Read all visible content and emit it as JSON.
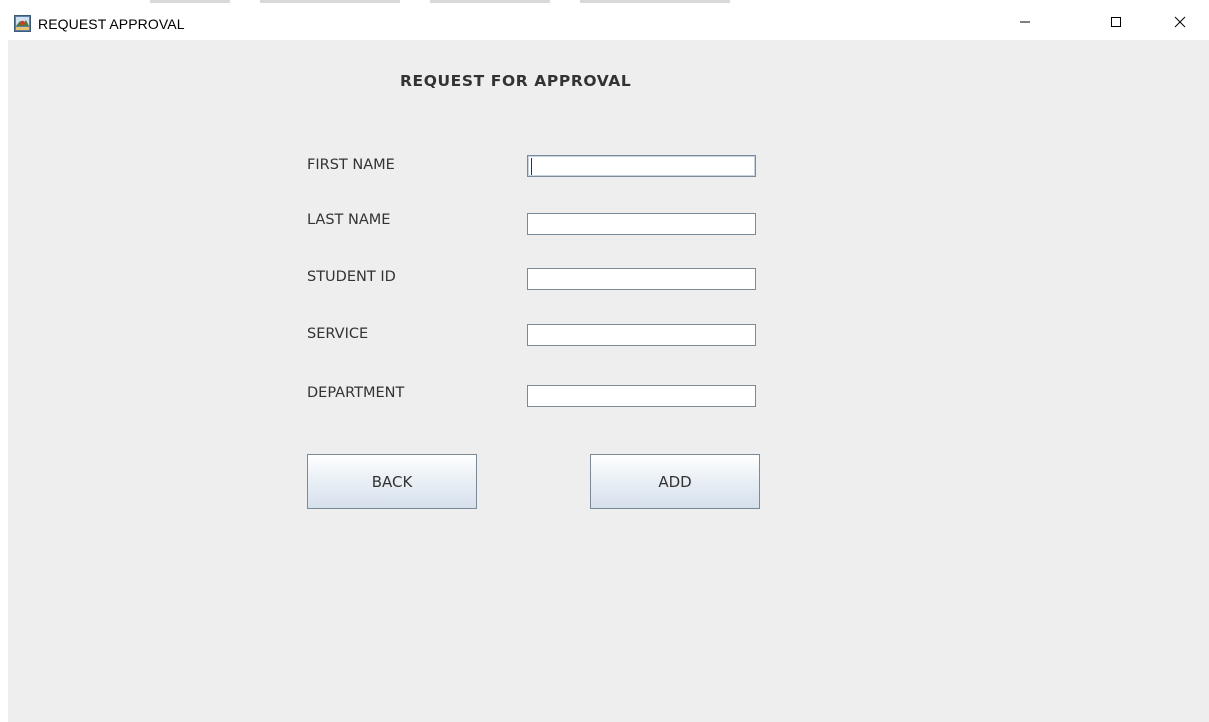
{
  "window": {
    "title": "REQUEST APPROVAL",
    "controls": {
      "minimize": "minimize-icon",
      "maximize": "maximize-icon",
      "close": "close-icon"
    }
  },
  "form": {
    "heading": "REQUEST FOR APPROVAL",
    "fields": [
      {
        "label": "FIRST NAME",
        "value": ""
      },
      {
        "label": "LAST NAME",
        "value": ""
      },
      {
        "label": "STUDENT ID",
        "value": ""
      },
      {
        "label": "SERVICE",
        "value": ""
      },
      {
        "label": "DEPARTMENT",
        "value": ""
      }
    ],
    "buttons": {
      "back": "BACK",
      "add": "ADD"
    }
  },
  "colors": {
    "background": "#eeeeee",
    "text": "#333333",
    "field_border": "#7a8a99",
    "button_gradient_top": "#ffffff",
    "button_gradient_bottom": "#d6e0ec"
  }
}
